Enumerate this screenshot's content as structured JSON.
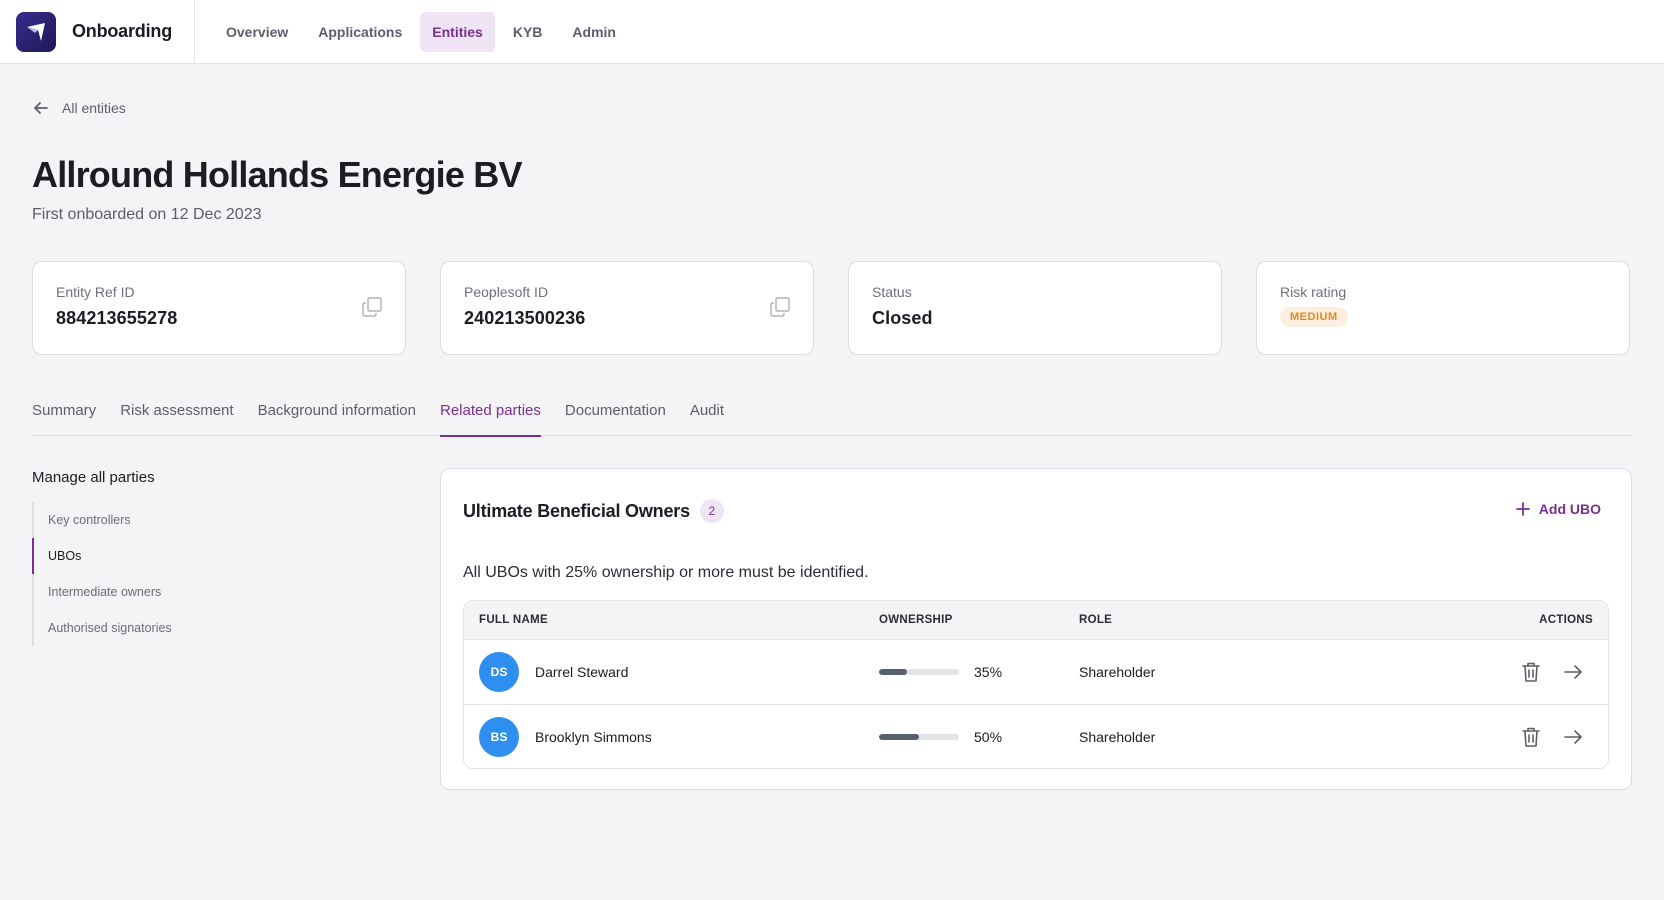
{
  "app": {
    "name": "Onboarding"
  },
  "nav": {
    "items": [
      {
        "label": "Overview",
        "active": false
      },
      {
        "label": "Applications",
        "active": false
      },
      {
        "label": "Entities",
        "active": true
      },
      {
        "label": "KYB",
        "active": false
      },
      {
        "label": "Admin",
        "active": false
      }
    ]
  },
  "back": {
    "label": "All entities",
    "icon": "arrow-left-icon"
  },
  "entity": {
    "name": "Allround Hollands Energie BV",
    "subtitle": "First onboarded on 12 Dec 2023"
  },
  "cards": {
    "ref": {
      "label": "Entity Ref ID",
      "value": "884213655278",
      "icon": "copy-icon"
    },
    "peoplesoft": {
      "label": "Peoplesoft ID",
      "value": "240213500236",
      "icon": "copy-icon"
    },
    "status": {
      "label": "Status",
      "value": "Closed"
    },
    "risk": {
      "label": "Risk rating",
      "value": "MEDIUM",
      "color": "#e38a1c"
    }
  },
  "tabs": [
    {
      "label": "Summary",
      "active": false
    },
    {
      "label": "Risk assessment",
      "active": false
    },
    {
      "label": "Background information",
      "active": false
    },
    {
      "label": "Related parties",
      "active": true
    },
    {
      "label": "Documentation",
      "active": false
    },
    {
      "label": "Audit",
      "active": false
    }
  ],
  "side": {
    "title": "Manage all parties",
    "items": [
      {
        "label": "Key controllers",
        "active": false
      },
      {
        "label": "UBOs",
        "active": true
      },
      {
        "label": "Intermediate owners",
        "active": false
      },
      {
        "label": "Authorised signatories",
        "active": false
      }
    ]
  },
  "ubo": {
    "title": "Ultimate Beneficial Owners",
    "count": "2",
    "add_label": "Add UBO",
    "description": "All UBOs with 25% ownership or more must be identified.",
    "columns": {
      "name": "FULL NAME",
      "ownership": "OWNERSHIP",
      "role": "ROLE",
      "actions": "ACTIONS"
    },
    "rows": [
      {
        "initials": "DS",
        "name": "Darrel Steward",
        "ownership_label": "35%",
        "ownership": 35,
        "role": "Shareholder"
      },
      {
        "initials": "BS",
        "name": "Brooklyn Simmons",
        "ownership_label": "50%",
        "ownership": 50,
        "role": "Shareholder"
      }
    ]
  },
  "colors": {
    "accent": "#7a2f8e",
    "avatar": "#2f8ff0",
    "background": "#f4f4f6"
  }
}
